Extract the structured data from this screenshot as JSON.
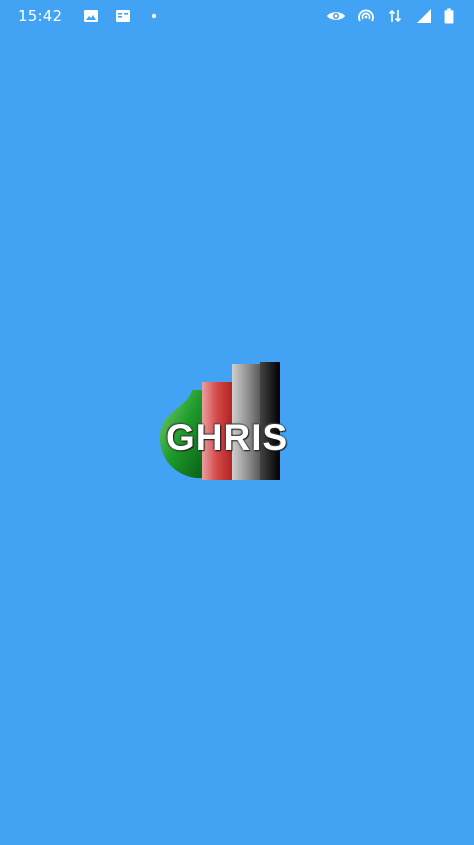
{
  "status_bar": {
    "time": "15:42",
    "left_icons": [
      "image-notification-icon",
      "calendar-notification-icon",
      "dot-icon"
    ],
    "right_icons": [
      "eye-icon",
      "hotspot-icon",
      "data-arrows-icon",
      "signal-icon",
      "battery-icon"
    ]
  },
  "splash": {
    "logo_text": "GHRIS",
    "background_color": "#42a2f3"
  }
}
